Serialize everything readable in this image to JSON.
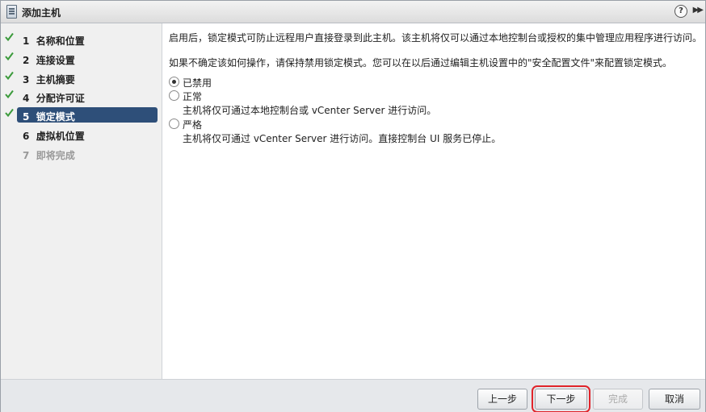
{
  "window": {
    "title": "添加主机",
    "icons": [
      "host-wizard-icon",
      "help-icon",
      "expand-icon"
    ]
  },
  "steps": [
    {
      "num": "1",
      "label": "名称和位置",
      "done": true
    },
    {
      "num": "2",
      "label": "连接设置",
      "done": true
    },
    {
      "num": "3",
      "label": "主机摘要",
      "done": true
    },
    {
      "num": "4",
      "label": "分配许可证",
      "done": true
    },
    {
      "num": "5",
      "label": "锁定模式",
      "done": true,
      "current": true
    },
    {
      "num": "6",
      "label": "虚拟机位置",
      "done": false
    },
    {
      "num": "7",
      "label": "即将完成",
      "done": false,
      "disabled": true
    }
  ],
  "content": {
    "intro": "启用后，锁定模式可防止远程用户直接登录到此主机。该主机将仅可以通过本地控制台或授权的集中管理应用程序进行访问。",
    "hint": "如果不确定该如何操作，请保持禁用锁定模式。您可以在以后通过编辑主机设置中的\"安全配置文件\"来配置锁定模式。",
    "options": [
      {
        "label": "已禁用",
        "desc": "",
        "selected": true
      },
      {
        "label": "正常",
        "desc": "主机将仅可通过本地控制台或 vCenter Server 进行访问。",
        "selected": false
      },
      {
        "label": "严格",
        "desc": "主机将仅可通过 vCenter Server 进行访问。直接控制台 UI 服务已停止。",
        "selected": false
      }
    ]
  },
  "footer": {
    "back": "上一步",
    "next": "下一步",
    "finish": "完成",
    "cancel": "取消"
  },
  "colors": {
    "current_step_bg": "#2e4f79",
    "check": "#3c9b3c",
    "highlight": "#e0242a"
  }
}
